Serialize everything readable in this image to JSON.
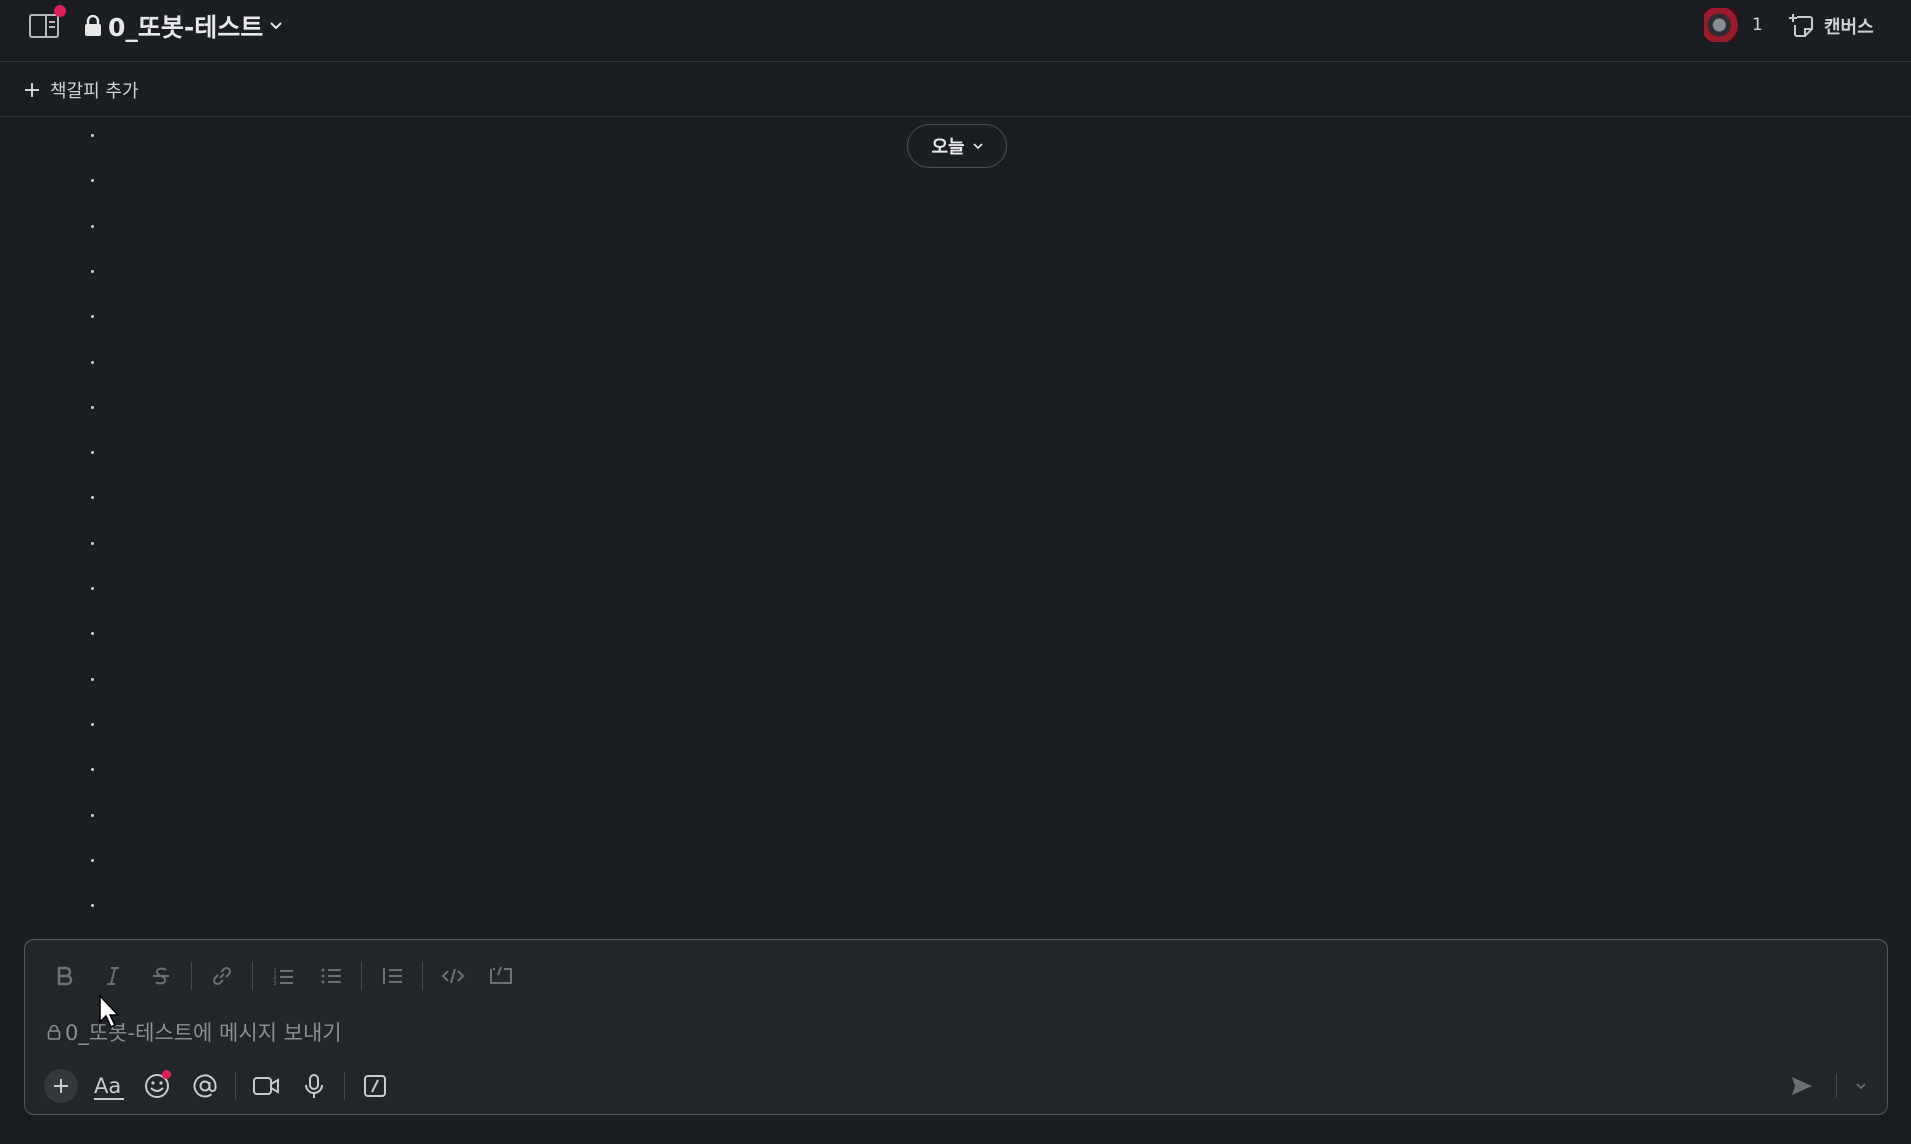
{
  "header": {
    "channel_name": "0_또봇-테스트",
    "member_count": "1",
    "canvas_label": "캔버스"
  },
  "bookmarks": {
    "add_label": "책갈피 추가"
  },
  "messages": {
    "date_label": "오늘",
    "bullet_count": 18
  },
  "composer": {
    "placeholder": "0_또봇-테스트에 메시지 보내기"
  },
  "colors": {
    "background": "#1a1d21",
    "composer_bg": "#222529",
    "notification": "#e01e5a",
    "text": "#d1d2d3",
    "muted": "#6b6e72"
  },
  "icons": {
    "header": [
      "sidebar-toggle-icon",
      "lock-icon",
      "chevron-down-icon",
      "canvas-icon"
    ],
    "format": [
      "bold-icon",
      "italic-icon",
      "strikethrough-icon",
      "link-icon",
      "ordered-list-icon",
      "bulleted-list-icon",
      "blockquote-icon",
      "code-icon",
      "code-block-icon"
    ],
    "actions": [
      "plus-icon",
      "formatting-toggle-icon",
      "emoji-icon",
      "mention-icon",
      "video-clip-icon",
      "audio-clip-icon",
      "slash-shortcut-icon",
      "send-icon"
    ]
  }
}
